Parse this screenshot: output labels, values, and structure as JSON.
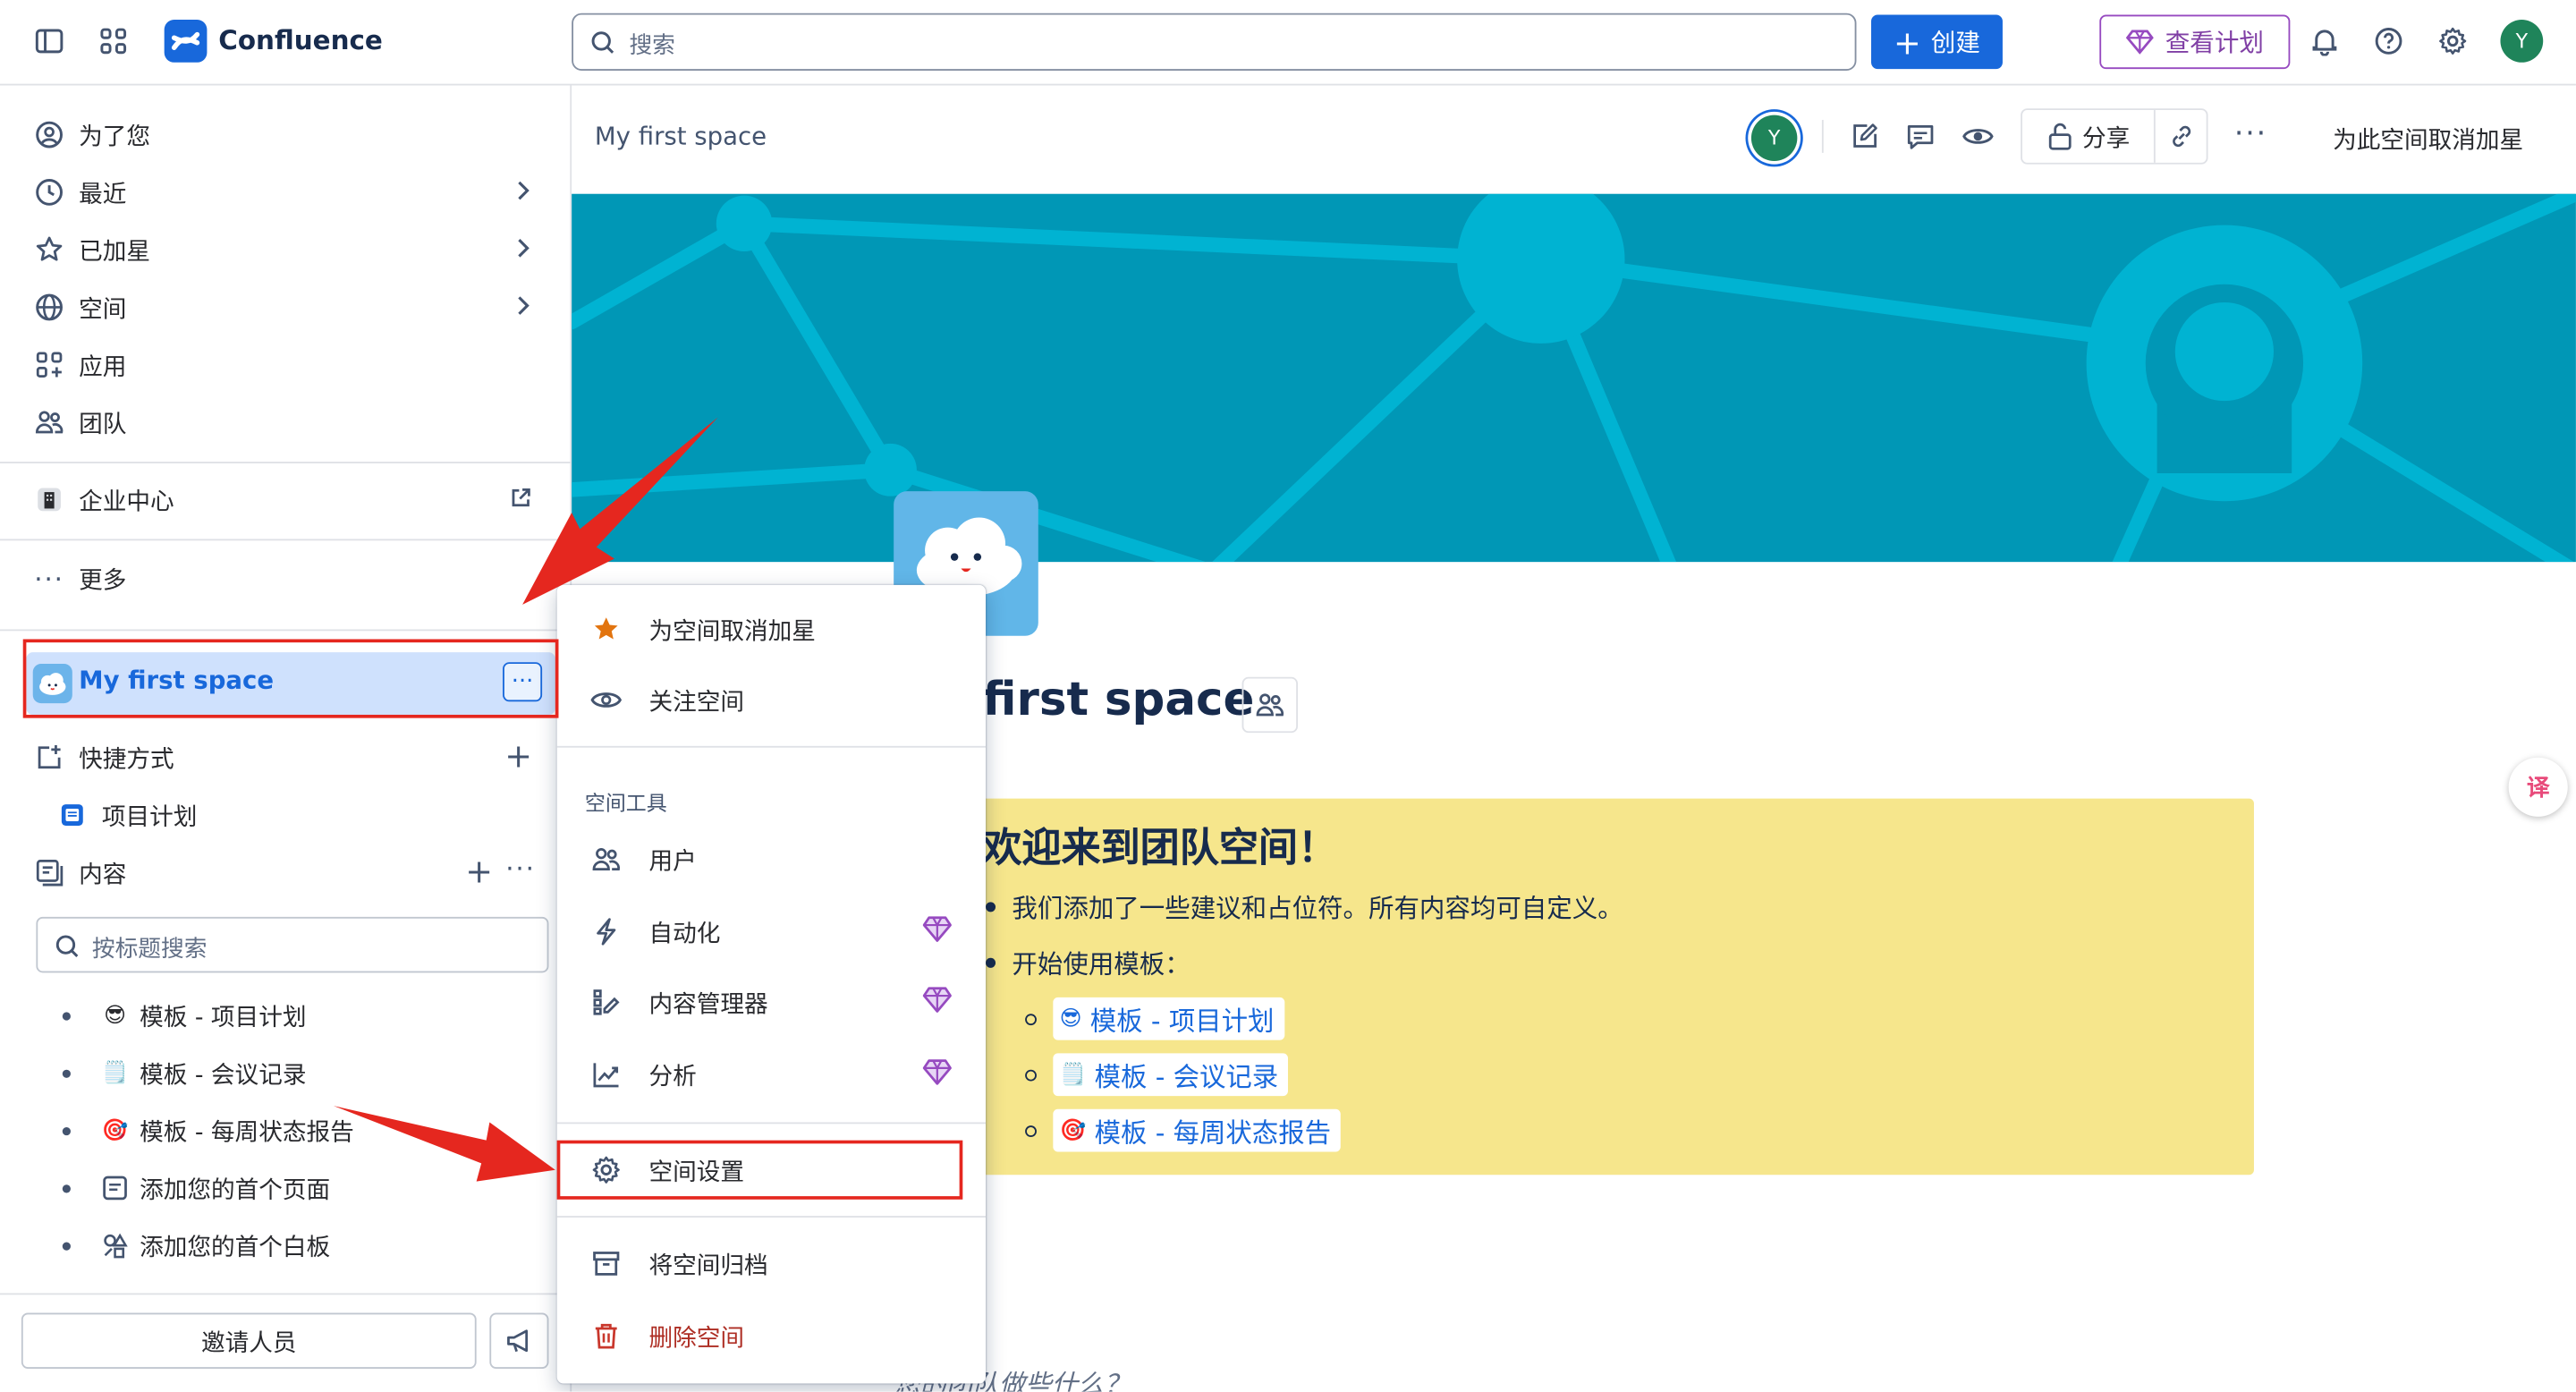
{
  "app": {
    "name": "Confluence"
  },
  "topbar": {
    "search_placeholder": "搜索",
    "create_label": "创建",
    "plan_label": "查看计划",
    "avatar_initial": "Y"
  },
  "sidebar": {
    "items": [
      {
        "label": "为了您"
      },
      {
        "label": "最近"
      },
      {
        "label": "已加星"
      },
      {
        "label": "空间"
      },
      {
        "label": "应用"
      },
      {
        "label": "团队"
      }
    ],
    "enterprise_label": "企业中心",
    "more_label": "更多",
    "space_name": "My first space",
    "shortcuts_label": "快捷方式",
    "shortcut_item": "项目计划",
    "content_label": "内容",
    "title_search_placeholder": "按标题搜索",
    "tree": [
      {
        "emoji": "😎",
        "label": "模板 - 项目计划"
      },
      {
        "emoji": "🗒️",
        "label": "模板 - 会议记录"
      },
      {
        "emoji": "🎯",
        "label": "模板 - 每周状态报告"
      },
      {
        "emoji": "",
        "label": "添加您的首个页面"
      },
      {
        "emoji": "",
        "label": "添加您的首个白板"
      }
    ],
    "invite_label": "邀请人员"
  },
  "main": {
    "breadcrumb": "My first space",
    "avatar_initial": "Y",
    "share_label": "分享",
    "unstar_label": "为此空间取消加星",
    "page_title": "first space",
    "panel_title": "欢迎来到团队空间！",
    "bullets": [
      "我们添加了一些建议和占位符。所有内容均可自定义。",
      "开始使用模板："
    ],
    "template_links": [
      {
        "emoji": "😎",
        "label": "模板 - 项目计划"
      },
      {
        "emoji": "🗒️",
        "label": "模板 - 会议记录"
      },
      {
        "emoji": "🎯",
        "label": "模板 - 每周状态报告"
      }
    ],
    "bottom_text": "您的团队做些什么？",
    "translate_label": "译"
  },
  "menu": {
    "unstar": "为空间取消加星",
    "watch": "关注空间",
    "section_title": "空间工具",
    "users": "用户",
    "automation": "自动化",
    "content_manager": "内容管理器",
    "analytics": "分析",
    "space_settings": "空间设置",
    "archive": "将空间归档",
    "delete": "删除空间"
  },
  "colors": {
    "brand_blue": "#1868db",
    "banner": "#0097b6",
    "panel_yellow": "#f6e68c",
    "annotation_red": "#e5271f",
    "premium_purple": "#964ac0",
    "danger": "#ae2e24"
  }
}
